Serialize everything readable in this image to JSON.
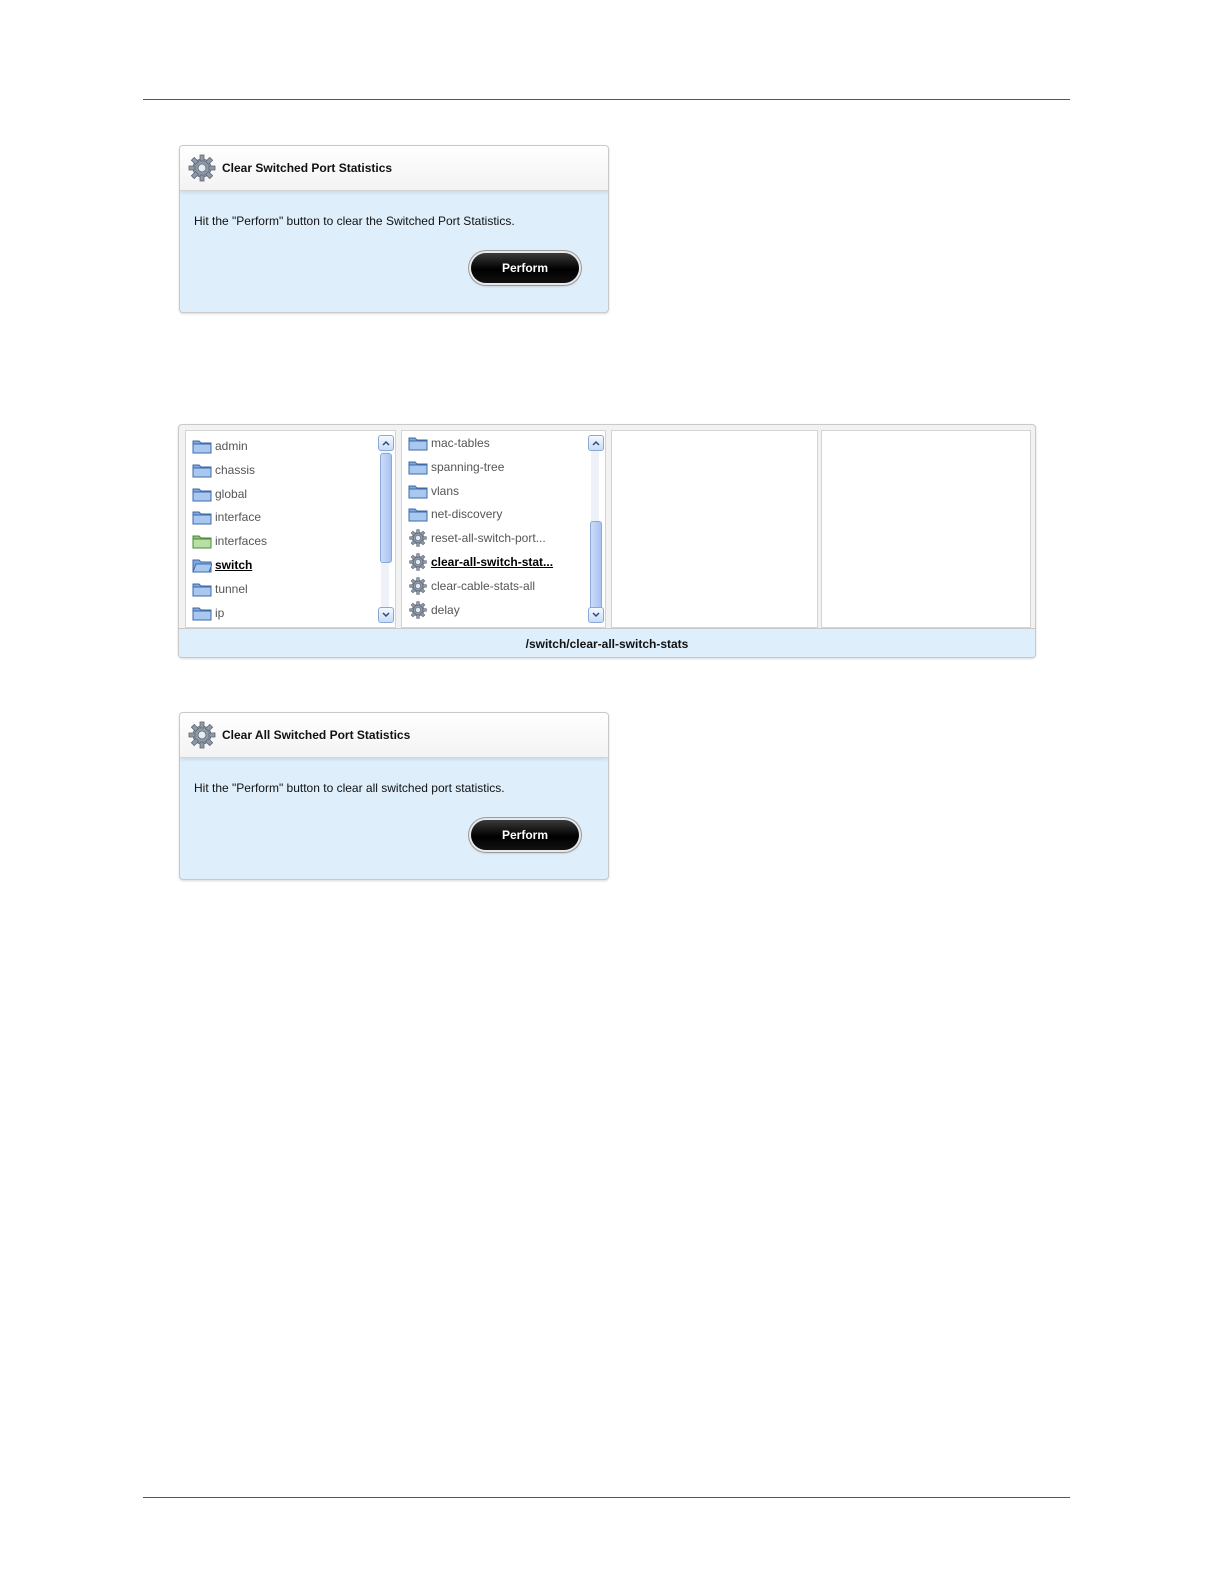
{
  "panel1": {
    "title": "Clear Switched Port Statistics",
    "message": "Hit the \"Perform\" button to clear the Switched Port Statistics.",
    "button": "Perform"
  },
  "browser": {
    "col1": [
      {
        "label": "admin",
        "icon": "folder-icon"
      },
      {
        "label": "chassis",
        "icon": "folder-icon"
      },
      {
        "label": "global",
        "icon": "folder-icon"
      },
      {
        "label": "interface",
        "icon": "folder-icon"
      },
      {
        "label": "interfaces",
        "icon": "folder-green-icon"
      },
      {
        "label": "switch",
        "icon": "folder-open-icon",
        "selected": true
      },
      {
        "label": "tunnel",
        "icon": "folder-icon"
      },
      {
        "label": "ip",
        "icon": "folder-icon"
      }
    ],
    "col2": [
      {
        "label": "mac-tables",
        "icon": "folder-icon"
      },
      {
        "label": "spanning-tree",
        "icon": "folder-icon"
      },
      {
        "label": "vlans",
        "icon": "folder-icon"
      },
      {
        "label": "net-discovery",
        "icon": "folder-icon"
      },
      {
        "label": "reset-all-switch-port...",
        "icon": "gear-icon"
      },
      {
        "label": "clear-all-switch-stat...",
        "icon": "gear-icon",
        "selected": true
      },
      {
        "label": "clear-cable-stats-all",
        "icon": "gear-icon"
      },
      {
        "label": "delay",
        "icon": "gear-icon"
      }
    ],
    "path": "/switch/clear-all-switch-stats"
  },
  "panel2": {
    "title": "Clear All Switched Port Statistics",
    "message": "Hit the \"Perform\" button to clear all switched port statistics.",
    "button": "Perform"
  }
}
